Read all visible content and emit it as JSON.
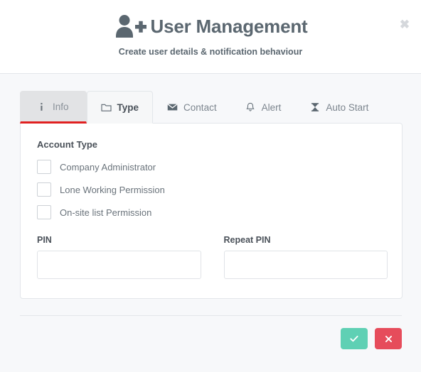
{
  "header": {
    "icon": "user-plus-icon",
    "title": "User Management",
    "subtitle": "Create user details & notification behaviour",
    "close_label": "✖"
  },
  "tabs": [
    {
      "id": "info",
      "label": "Info",
      "icon": "info-icon",
      "state": "underlined"
    },
    {
      "id": "type",
      "label": "Type",
      "icon": "folder-icon",
      "state": "active"
    },
    {
      "id": "contact",
      "label": "Contact",
      "icon": "envelope-icon",
      "state": "default"
    },
    {
      "id": "alert",
      "label": "Alert",
      "icon": "bell-icon",
      "state": "default"
    },
    {
      "id": "auto-start",
      "label": "Auto Start",
      "icon": "hourglass-icon",
      "state": "default"
    }
  ],
  "panel": {
    "section_title": "Account Type",
    "checkboxes": [
      {
        "label": "Company Administrator",
        "checked": false
      },
      {
        "label": "Lone Working Permission",
        "checked": false
      },
      {
        "label": "On-site list Permission",
        "checked": false
      }
    ],
    "fields": [
      {
        "label": "PIN",
        "value": "",
        "placeholder": ""
      },
      {
        "label": "Repeat PIN",
        "value": "",
        "placeholder": ""
      }
    ]
  },
  "footer": {
    "confirm": {
      "name": "confirm-button",
      "icon": "check-icon",
      "color": "#5fd0b4"
    },
    "cancel": {
      "name": "cancel-button",
      "icon": "cross-icon",
      "color": "#e64c5b"
    }
  }
}
